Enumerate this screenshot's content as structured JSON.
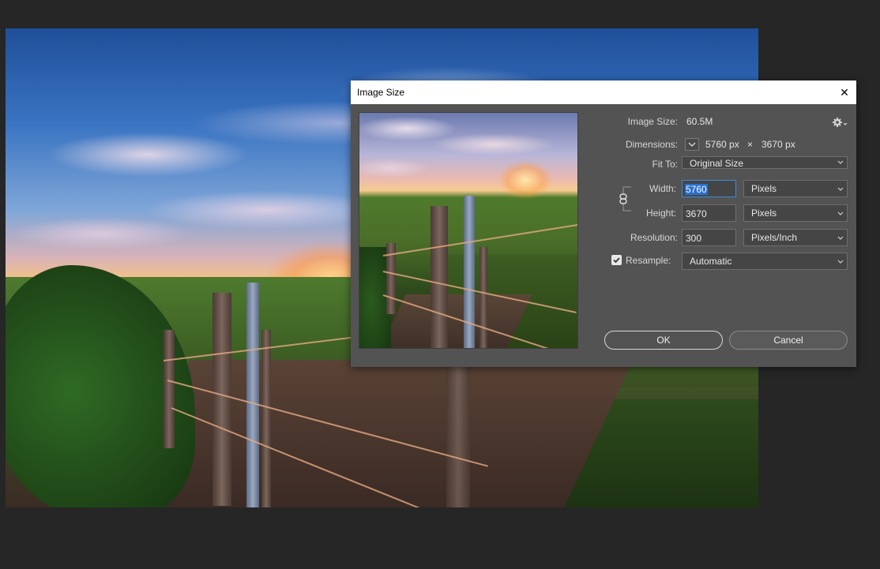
{
  "dialog": {
    "title": "Image Size",
    "close_glyph": "✕",
    "image_size_label": "Image Size:",
    "image_size_value": "60.5M",
    "dimensions_label": "Dimensions:",
    "dimensions_width": "5760 px",
    "dimensions_times": "×",
    "dimensions_height": "3670 px",
    "fit_to_label": "Fit To:",
    "fit_to_value": "Original Size",
    "width_label": "Width:",
    "width_value": "5760",
    "width_unit": "Pixels",
    "height_label": "Height:",
    "height_value": "3670",
    "height_unit": "Pixels",
    "resolution_label": "Resolution:",
    "resolution_value": "300",
    "resolution_unit": "Pixels/Inch",
    "resample_label": "Resample:",
    "resample_checked": true,
    "resample_value": "Automatic",
    "ok_label": "OK",
    "cancel_label": "Cancel"
  },
  "icons": {
    "settings": "gear-icon",
    "dimensions_toggle": "chevron-down-icon",
    "constrain": "link-icon",
    "close": "close-icon",
    "checkbox": "checkmark-icon"
  },
  "colors": {
    "app_background": "#262626",
    "dialog_background": "#535353",
    "titlebar_background": "#ffffff",
    "focus_accent": "#2a6fd1"
  }
}
